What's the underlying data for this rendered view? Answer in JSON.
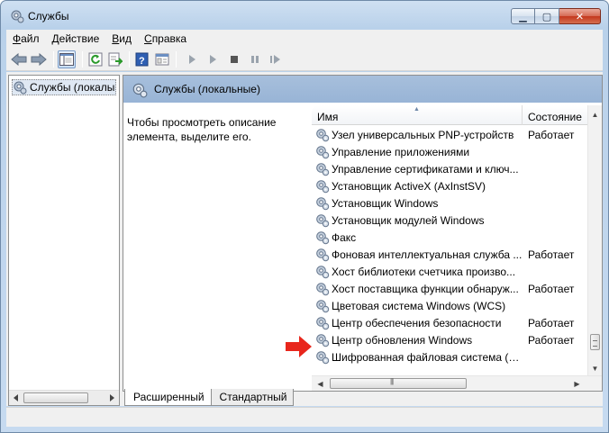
{
  "window": {
    "title": "Службы",
    "controls": {
      "minimize": "▁",
      "maximize": "▢",
      "close": "✕"
    }
  },
  "menu": [
    {
      "label": "Файл",
      "accel": "Ф",
      "rest": "айл"
    },
    {
      "label": "Действие",
      "accel": "Д",
      "rest": "ействие"
    },
    {
      "label": "Вид",
      "accel": "В",
      "rest": "ид"
    },
    {
      "label": "Справка",
      "accel": "С",
      "rest": "правка"
    }
  ],
  "toolbar": {
    "icons": [
      "back-arrow-icon",
      "forward-arrow-icon",
      "console-tree-icon",
      "refresh-icon",
      "export-list-icon",
      "help-icon",
      "properties-icon",
      "play-icon",
      "play-alt-icon",
      "stop-icon",
      "pause-icon",
      "restart-icon"
    ]
  },
  "tree": {
    "selected_label": "Службы (локалы"
  },
  "right_pane": {
    "header_title": "Службы (локальные)",
    "description": "Чтобы просмотреть описание элемента, выделите его.",
    "columns": {
      "name": "Имя",
      "state": "Состояние"
    },
    "services": [
      {
        "name": "Узел универсальных PNP-устройств",
        "state": "Работает"
      },
      {
        "name": "Управление приложениями",
        "state": ""
      },
      {
        "name": "Управление сертификатами и ключ...",
        "state": ""
      },
      {
        "name": "Установщик ActiveX (AxInstSV)",
        "state": ""
      },
      {
        "name": "Установщик Windows",
        "state": ""
      },
      {
        "name": "Установщик модулей Windows",
        "state": ""
      },
      {
        "name": "Факс",
        "state": ""
      },
      {
        "name": "Фоновая интеллектуальная служба ...",
        "state": "Работает"
      },
      {
        "name": "Хост библиотеки счетчика произво...",
        "state": ""
      },
      {
        "name": "Хост поставщика функции обнаруж...",
        "state": "Работает"
      },
      {
        "name": "Цветовая система Windows (WCS)",
        "state": ""
      },
      {
        "name": "Центр обеспечения безопасности",
        "state": "Работает"
      },
      {
        "name": "Центр обновления Windows",
        "state": "Работает"
      },
      {
        "name": "Шифрованная файловая система (E...",
        "state": ""
      }
    ],
    "tabs": [
      {
        "label": "Расширенный",
        "selected": true
      },
      {
        "label": "Стандартный",
        "selected": false
      }
    ]
  },
  "colors": {
    "header_band": "#a7bfdc",
    "annotation_arrow": "#e8261c",
    "close_button": "#c4381d"
  }
}
